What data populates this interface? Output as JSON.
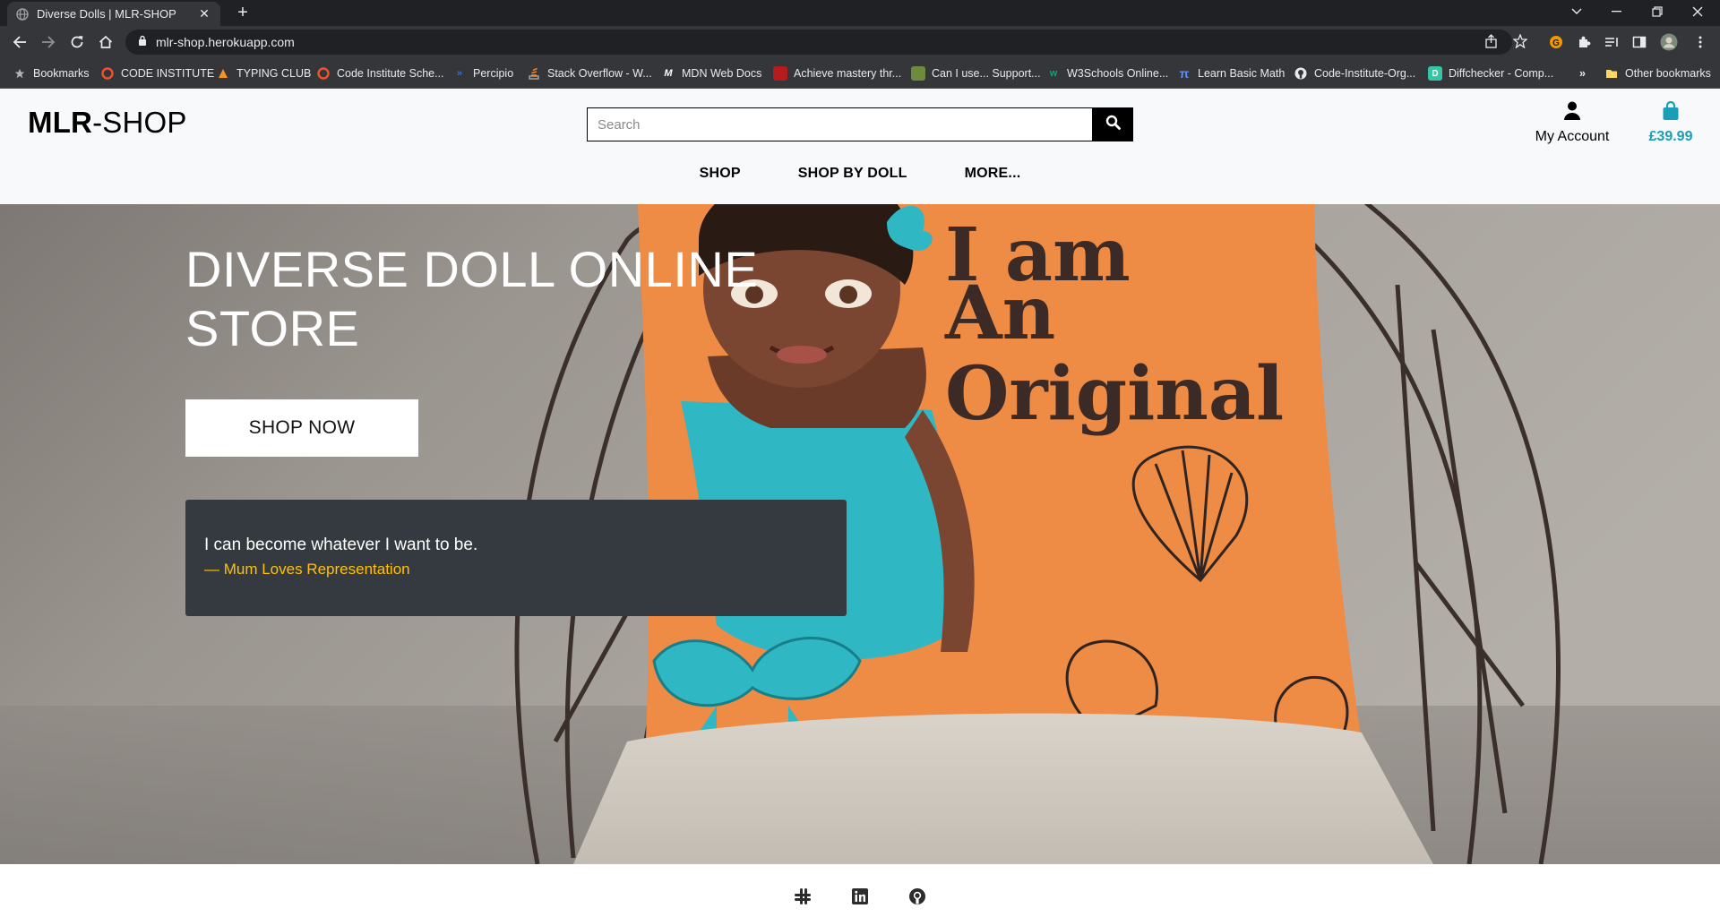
{
  "browser": {
    "tab_title": "Diverse Dolls | MLR-SHOP",
    "tab_close": "✕",
    "new_tab": "+",
    "url": "mlr-shop.herokuapp.com",
    "bookmarks": [
      {
        "label": "Bookmarks",
        "icon": "star-icon"
      },
      {
        "label": "CODE INSTITUTE",
        "icon": "code-institute-icon"
      },
      {
        "label": "TYPING CLUB",
        "icon": "typing-club-icon"
      },
      {
        "label": "Code Institute Sche...",
        "icon": "code-institute-icon"
      },
      {
        "label": "Percipio",
        "icon": "percipio-icon"
      },
      {
        "label": "Stack Overflow - W...",
        "icon": "stack-overflow-icon"
      },
      {
        "label": "MDN Web Docs",
        "icon": "mdn-icon"
      },
      {
        "label": "Achieve mastery thr...",
        "icon": "bookmark-red-icon"
      },
      {
        "label": "Can I use... Support...",
        "icon": "caniuse-icon"
      },
      {
        "label": "W3Schools Online...",
        "icon": "w3schools-icon"
      },
      {
        "label": "Learn Basic Math",
        "icon": "pi-icon"
      },
      {
        "label": "Code-Institute-Org...",
        "icon": "github-icon"
      },
      {
        "label": "Diffchecker - Comp...",
        "icon": "diffchecker-icon"
      },
      {
        "label": "»",
        "icon": "overflow-chevron-icon"
      },
      {
        "label": "Other bookmarks",
        "icon": "folder-icon"
      }
    ]
  },
  "header": {
    "brand_bold": "MLR",
    "brand_rest": "-SHOP",
    "search_placeholder": "Search",
    "account_label": "My Account",
    "basket_total": "£39.99",
    "accent_color": "#1a9eb8",
    "nav": [
      "SHOP",
      "SHOP BY DOLL",
      "MORE..."
    ]
  },
  "hero": {
    "title": "DIVERSE DOLL ONLINE STORE",
    "cta": "SHOP NOW",
    "quote_text": "I can become whatever I want to be.",
    "quote_cite": "— Mum Loves Representation",
    "cite_color": "#ffc107",
    "pillow_text": [
      "I am",
      "An",
      "Original"
    ]
  },
  "footer": {
    "icons": [
      "slack-icon",
      "linkedin-icon",
      "github-icon"
    ]
  }
}
